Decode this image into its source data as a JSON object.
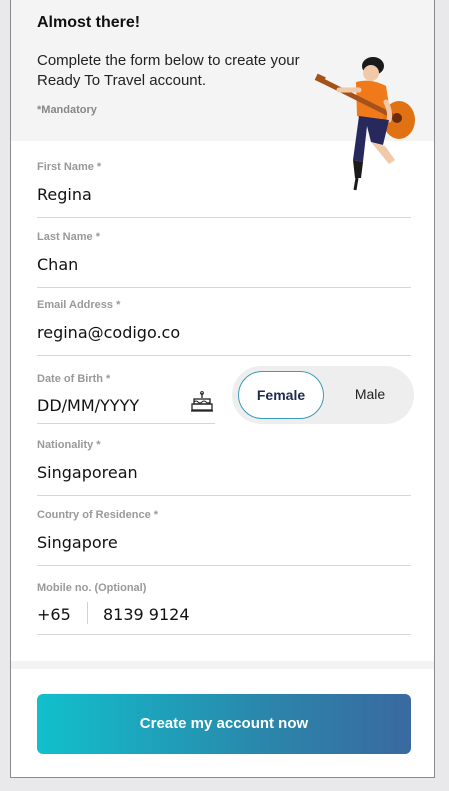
{
  "header": {
    "title": "Almost there!",
    "subtitle": "Complete the form below to create your Ready To Travel account.",
    "mandatory_note": "*Mandatory",
    "illustration": "guitar-player-illustration"
  },
  "fields": {
    "first_name": {
      "label": "First Name *",
      "value": "Regina"
    },
    "last_name": {
      "label": "Last Name *",
      "value": "Chan"
    },
    "email": {
      "label": "Email Address *",
      "value": "regina@codigo.co"
    },
    "dob": {
      "label": "Date of Birth *",
      "placeholder": "DD/MM/YYYY",
      "icon": "birthday-cake-icon"
    },
    "nationality": {
      "label": "Nationality *",
      "value": "Singaporean"
    },
    "residence": {
      "label": "Country of Residence *",
      "value": "Singapore"
    },
    "mobile": {
      "label": "Mobile no. (Optional)",
      "country_code": "+65",
      "number": "8139 9124"
    }
  },
  "gender": {
    "options": [
      "Female",
      "Male"
    ],
    "selected": "Female"
  },
  "cta": {
    "label": "Create my account now"
  },
  "colors": {
    "accent_border": "#3a9bbd",
    "cta_gradient_start": "#11c0cc",
    "cta_gradient_end": "#3a69a0",
    "header_bg": "#f4f4f4"
  }
}
